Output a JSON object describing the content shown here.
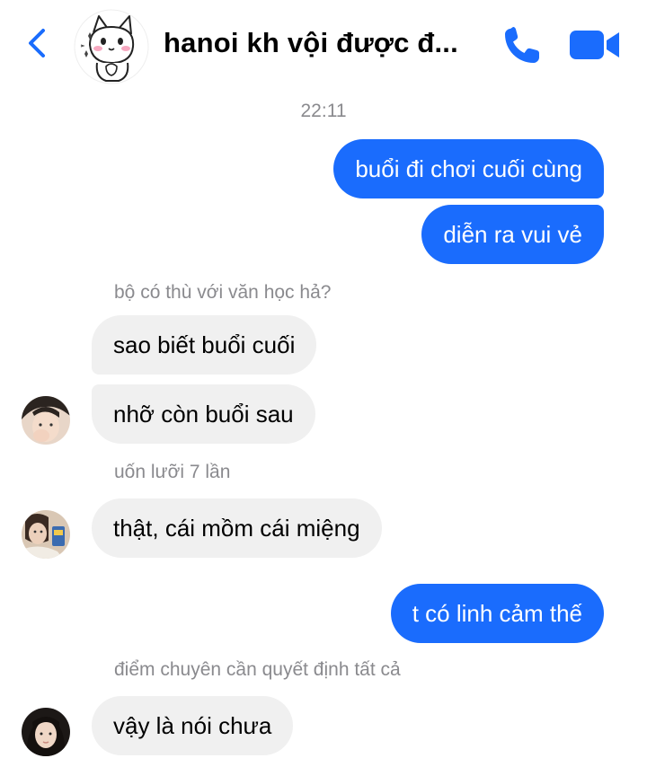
{
  "header": {
    "title": "hanoi kh vội được đ...",
    "back_icon": "chevron-left-icon",
    "call_icon": "phone-icon",
    "video_icon": "video-camera-icon"
  },
  "colors": {
    "accent": "#1a6cfd",
    "incoming_bubble": "#f0f0f0",
    "meta_text": "#8a8a8e"
  },
  "conversation": {
    "timestamp": "22:11",
    "messages": [
      {
        "direction": "outgoing",
        "text": "buổi đi chơi cuối cùng"
      },
      {
        "direction": "outgoing",
        "text": "diễn ra vui vẻ"
      },
      {
        "direction": "incoming",
        "reply_to": "bộ có thù với văn học hả?",
        "text": "sao biết buổi cuối"
      },
      {
        "direction": "incoming",
        "text": "nhỡ còn buổi sau"
      },
      {
        "direction": "incoming",
        "reply_to": "uốn lưỡi 7 lần",
        "text": "thật, cái mồm cái miệng"
      },
      {
        "direction": "outgoing",
        "text": "t có linh cảm thế"
      },
      {
        "direction": "incoming",
        "reply_to": "điểm chuyên cần quyết định tất cả",
        "text": "vậy là nói chưa"
      }
    ]
  }
}
